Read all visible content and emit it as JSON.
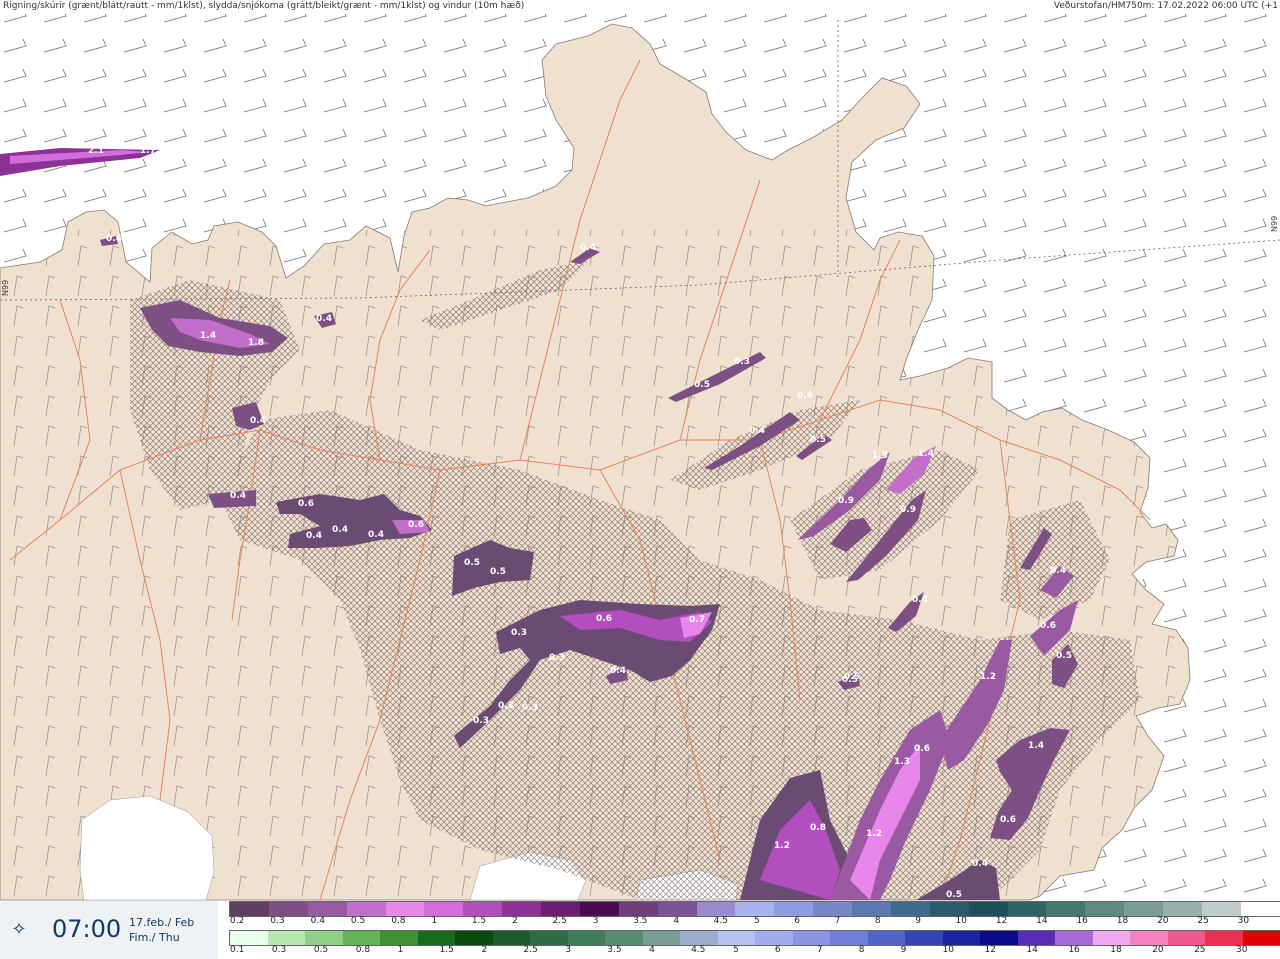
{
  "header": {
    "left_text": "Rigning/skúrir (grænt/blátt/rautt - mm/1klst), slydda/snjókoma (grátt/bleikt/grænt - mm/1klst) og vindur (10m hæð)",
    "right_text": "Veðurstofan/HM750m: 17.02.2022 06:00 UTC (+1"
  },
  "grid_labels": {
    "left": "N99",
    "right": "N99"
  },
  "time_panel": {
    "time": "07:00",
    "date_line1": "17.feb./ Feb",
    "date_line2": "Fim./ Thu",
    "logo_icon": "wind-star-icon"
  },
  "precip_labels": [
    "2.1",
    "1.7",
    "0.4",
    "1.4",
    "1.8",
    "0.4",
    "0.4",
    "0.4",
    "0.4",
    "0.6",
    "0.4",
    "0.4",
    "0.6",
    "0.5",
    "0.5",
    "0.3",
    "0.3",
    "0.3",
    "0.3",
    "0.3",
    "0.6",
    "0.7",
    "0.4",
    "0.5",
    "0.3",
    "0.4",
    "0.4",
    "0.5",
    "1.3",
    "1.4",
    "0.9",
    "0.9",
    "0.4",
    "0.5",
    "1.2",
    "0.8",
    "1.3",
    "1.2",
    "0.6",
    "1.2",
    "0.6",
    "0.4",
    "0.5",
    "0.5",
    "0.4",
    "1.4",
    "0.6",
    "0.5",
    "0.4"
  ],
  "legend": {
    "snow_colors": [
      "#5e3f60",
      "#7e4f82",
      "#9a5aa1",
      "#c26fcc",
      "#e886ec",
      "#d36ddc",
      "#b24ebd",
      "#8e3197",
      "#6c1d74",
      "#4a0c50",
      "#6e3f78",
      "#7a5295",
      "#9a8ad0",
      "#aab3f0",
      "#8f9de0",
      "#7688c8",
      "#5c78b0",
      "#3f6a8c",
      "#2b5b6c",
      "#1f4f58",
      "#2f6464",
      "#46776e",
      "#5f8a82",
      "#7a9c96",
      "#99b0ad",
      "#bfcccb",
      "#ffffff"
    ],
    "snow_labels": [
      "0.2",
      "0.3",
      "0.4",
      "0.5",
      "0.8",
      "1",
      "1.5",
      "2",
      "2.5",
      "3",
      "3.5",
      "4",
      "4.5",
      "5",
      "6",
      "7",
      "8",
      "9",
      "10",
      "12",
      "14",
      "16",
      "18",
      "20",
      "25",
      "30"
    ],
    "rain_colors": [
      "#e8ffe8",
      "#b9e6b2",
      "#8fce86",
      "#64b35a",
      "#3d8f38",
      "#176b1c",
      "#0a4a10",
      "#1f5a2a",
      "#2f6e44",
      "#3f7c58",
      "#5a8c74",
      "#7a9e96",
      "#9aaecc",
      "#b8c2f2",
      "#a0acec",
      "#8a96e4",
      "#6f7fd8",
      "#5264c8",
      "#3444b4",
      "#1a24a0",
      "#0a0a8c",
      "#5a2ab8",
      "#a66ad8",
      "#f0a8f0",
      "#f680c0",
      "#f05a8a",
      "#e83050",
      "#e00000"
    ],
    "rain_labels": [
      "0.1",
      "0.3",
      "0.5",
      "0.8",
      "1",
      "1.5",
      "2",
      "2.5",
      "3",
      "3.5",
      "4",
      "4.5",
      "5",
      "6",
      "7",
      "8",
      "9",
      "10",
      "12",
      "14",
      "16",
      "18",
      "20",
      "25",
      "30"
    ]
  }
}
